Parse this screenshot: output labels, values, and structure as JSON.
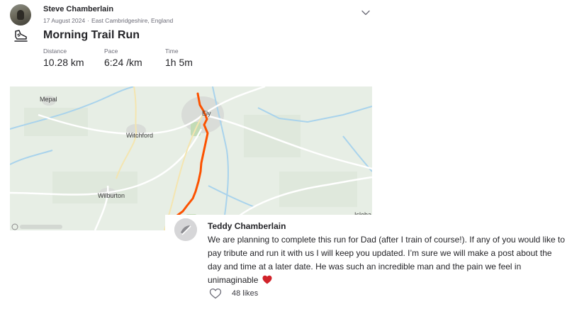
{
  "athlete": {
    "name": "Steve Chamberlain",
    "date": "17 August 2024",
    "separator": "·",
    "location": "East Cambridgeshire, England"
  },
  "activity": {
    "sport_icon": "hiking-shoe-icon",
    "title": "Morning Trail Run",
    "stats": [
      {
        "label": "Distance",
        "value": "10.28 km"
      },
      {
        "label": "Pace",
        "value": "6:24 /km"
      },
      {
        "label": "Time",
        "value": "1h 5m"
      }
    ]
  },
  "map": {
    "places": [
      "Mepal",
      "Ely",
      "Witchford",
      "Wilburton",
      "Isleha"
    ],
    "route_color": "#fc5200",
    "land_color": "#e7eee5",
    "water_color": "#a9d3ec"
  },
  "comment": {
    "author": "Teddy Chamberlain",
    "text": "We are planning to complete this run for Dad (after I train of course!). If any of you would like to pay tribute and run it with us I will keep you updated. I’m sure we will make a post about the day and time at a later date. He was such an incredible man and the pain we feel in unimaginable",
    "emoji": "red-heart-icon",
    "likes": "48 likes"
  }
}
